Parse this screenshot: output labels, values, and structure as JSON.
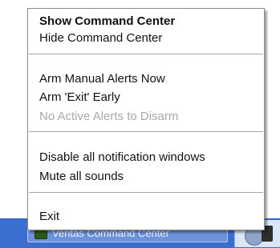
{
  "taskbar": {
    "task_label": "Veritas Command Center"
  },
  "menu": {
    "items": [
      {
        "label": "Show Command Center"
      },
      {
        "label": "Hide Command Center"
      },
      {
        "label": "Arm Manual Alerts Now"
      },
      {
        "label": "Arm 'Exit' Early"
      },
      {
        "label": "No Active Alerts to Disarm"
      },
      {
        "label": "Disable all notification windows"
      },
      {
        "label": "Mute all sounds"
      },
      {
        "label": "Exit"
      }
    ]
  }
}
